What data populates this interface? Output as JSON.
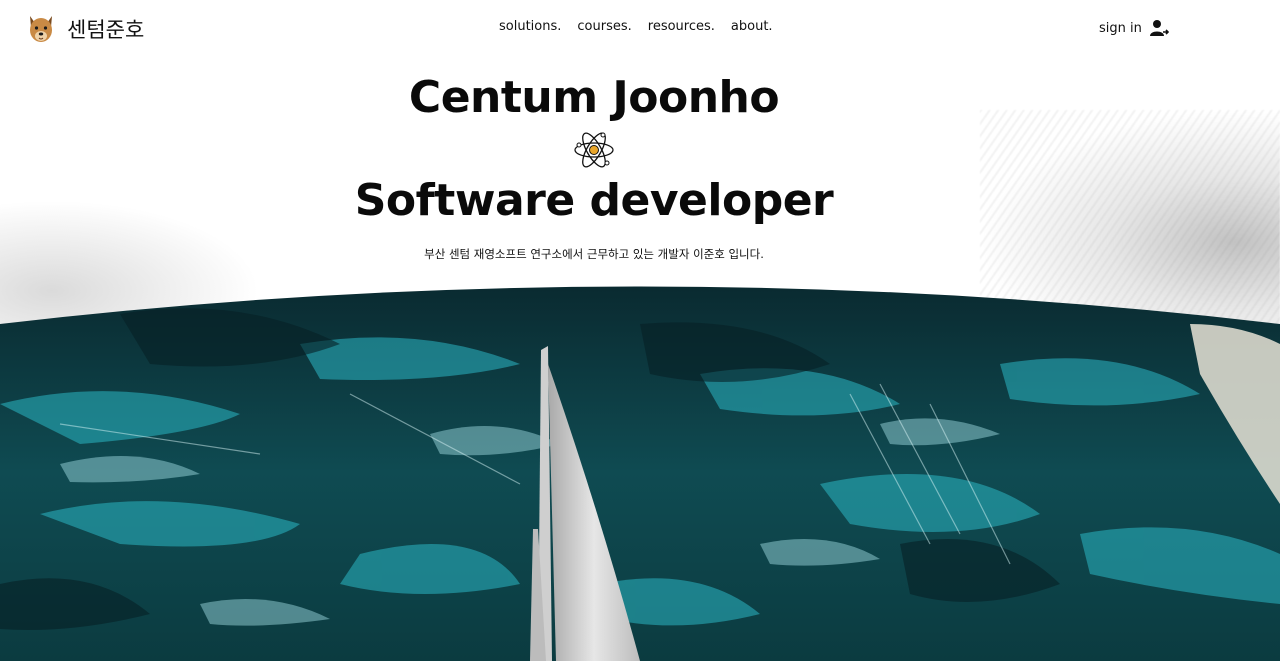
{
  "header": {
    "brand": "센텀준호",
    "nav": [
      {
        "label": "solutions."
      },
      {
        "label": "courses."
      },
      {
        "label": "resources."
      },
      {
        "label": "about."
      }
    ],
    "signin_label": "sign in"
  },
  "hero": {
    "title": "Centum Joonho",
    "subtitle": "Software developer",
    "description": "부산 센텀 재영소프트 연구소에서 근무하고 있는 개발자 이준호 입니다."
  },
  "icons": {
    "logo": "dog-icon",
    "signin": "user-plus-icon",
    "divider": "atom-icon"
  },
  "colors": {
    "text": "#0a0a0a",
    "ocean_dark": "#0d3b3f",
    "ocean_teal": "#1fa9b7",
    "sail": "#d8d8d8"
  }
}
